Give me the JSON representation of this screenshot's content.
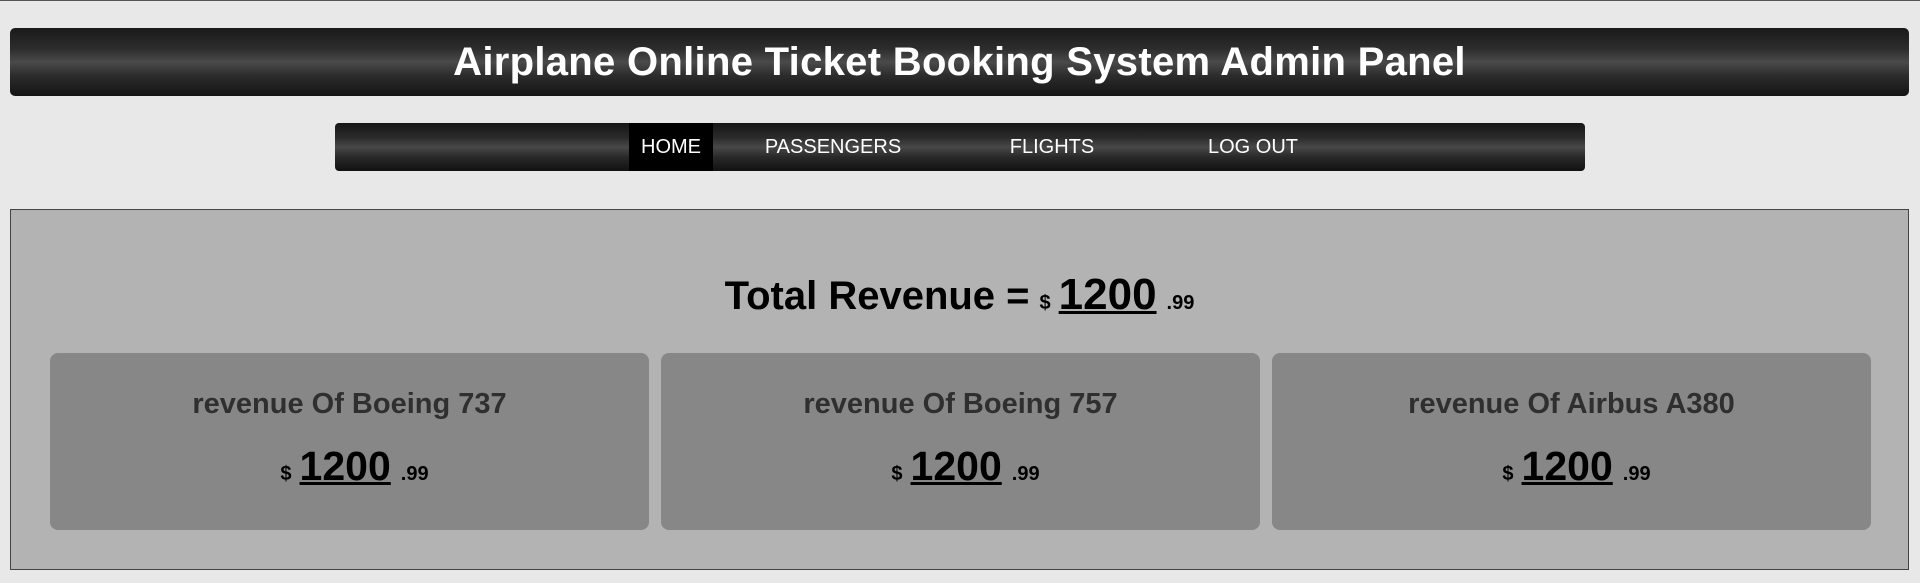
{
  "header": {
    "title": "Airplane Online Ticket Booking System Admin Panel"
  },
  "nav": {
    "items": [
      {
        "label": "HOME",
        "active": true
      },
      {
        "label": "PASSENGERS",
        "active": false
      },
      {
        "label": "FLIGHTS",
        "active": false
      },
      {
        "label": "LOG OUT",
        "active": false
      }
    ]
  },
  "summary": {
    "label": "Total Revenue =",
    "currency": "$",
    "amount": "1200",
    "cents": ".99"
  },
  "cards": [
    {
      "title": "revenue Of Boeing 737",
      "currency": "$",
      "amount": "1200",
      "cents": ".99"
    },
    {
      "title": "revenue Of Boeing 757",
      "currency": "$",
      "amount": "1200",
      "cents": ".99"
    },
    {
      "title": "revenue Of Airbus A380",
      "currency": "$",
      "amount": "1200",
      "cents": ".99"
    }
  ],
  "colors": {
    "page_background": "#e8e8e8",
    "bar_dark": "#1a1a1a",
    "panel": "#b3b3b3",
    "card": "#878787",
    "card_title": "#2f2f2f"
  }
}
